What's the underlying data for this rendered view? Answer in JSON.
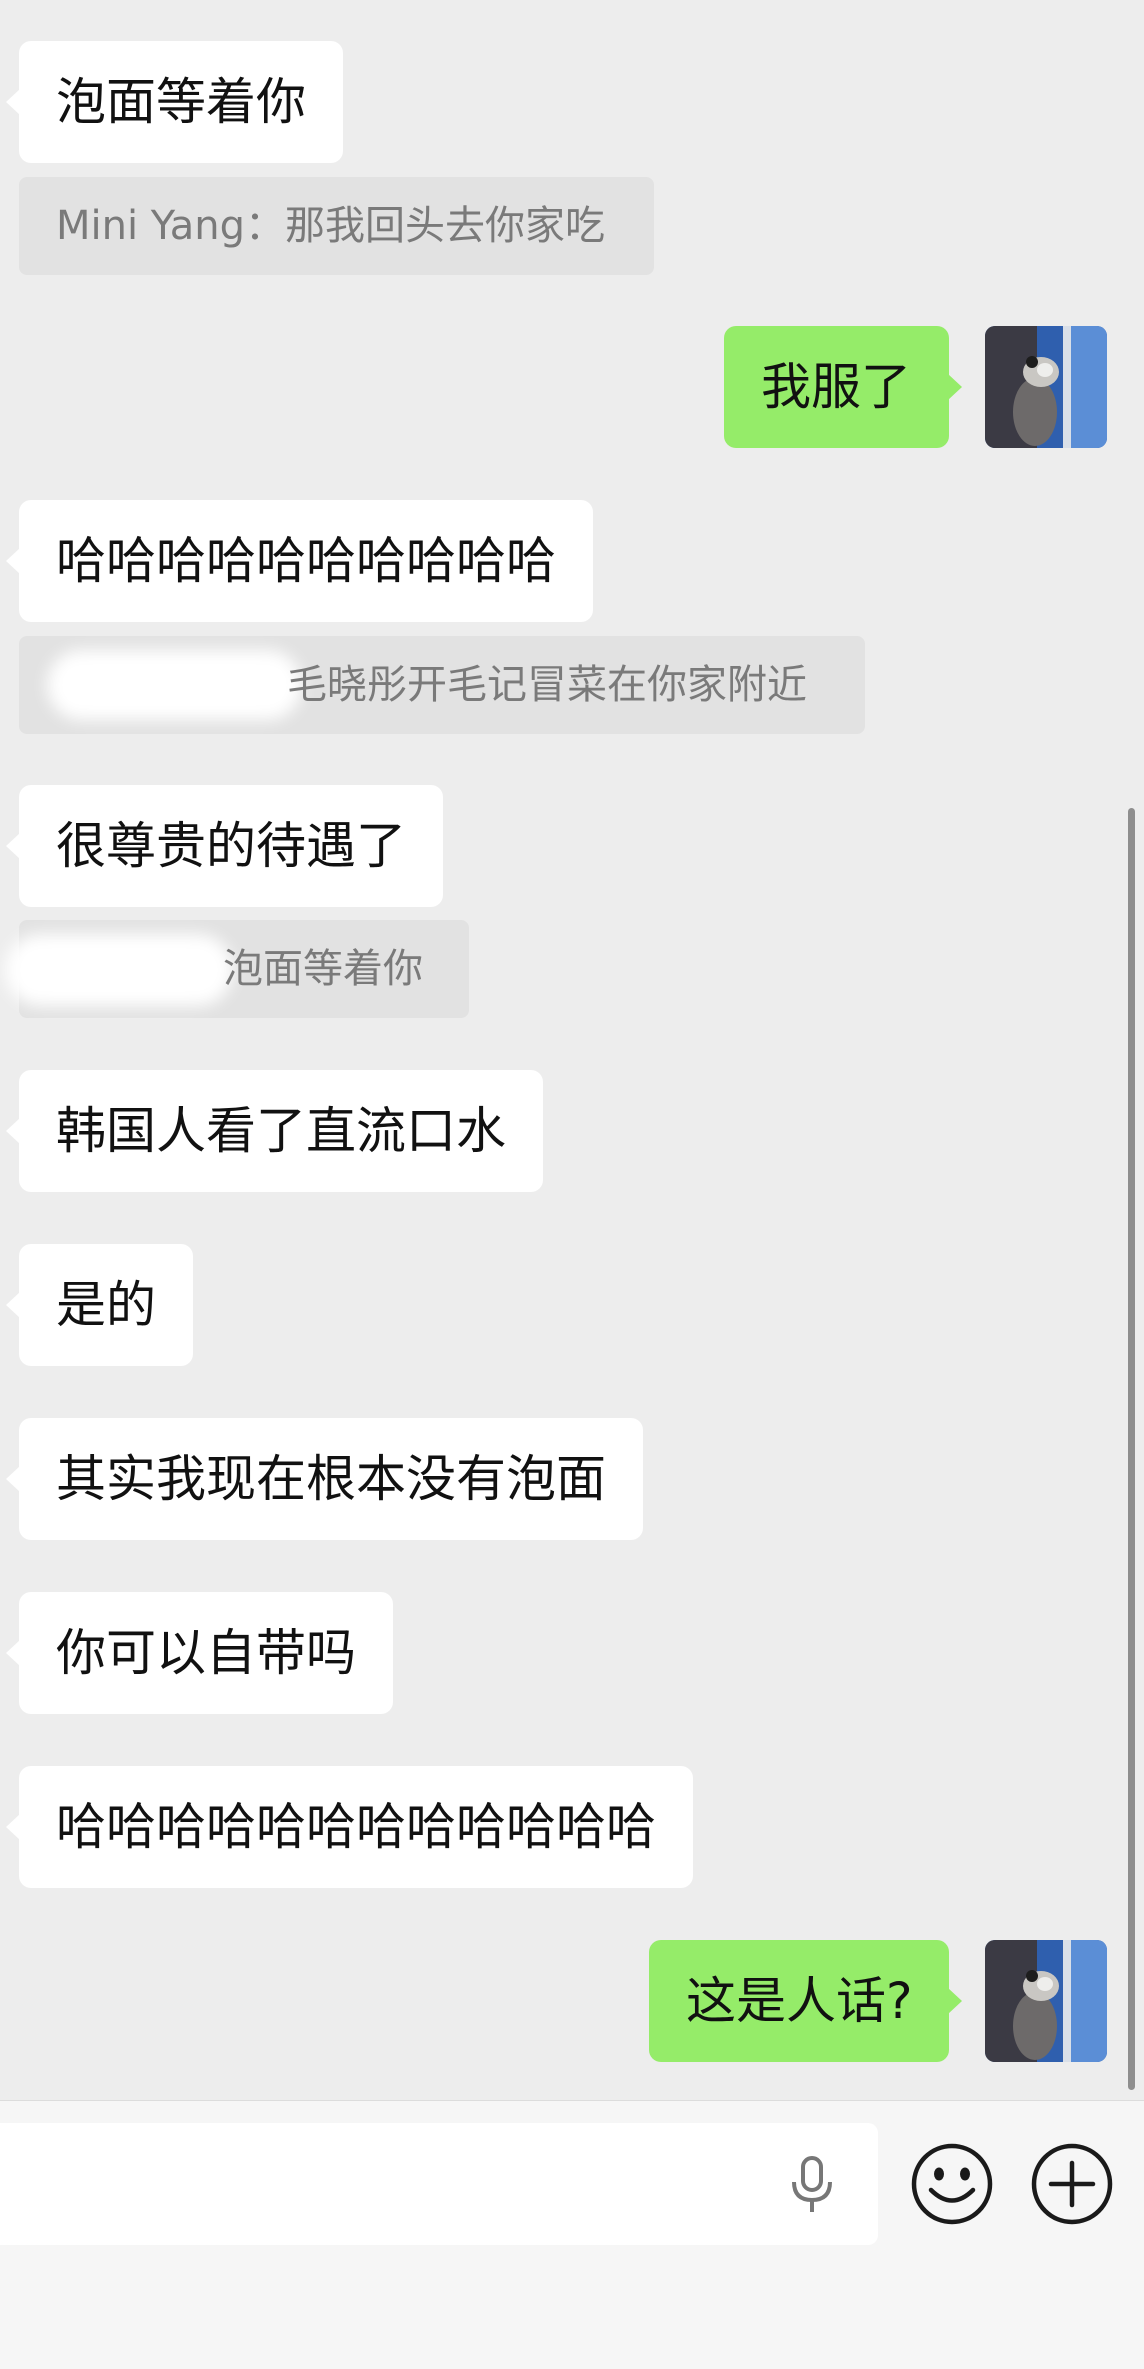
{
  "messages": [
    {
      "side": "in",
      "text": "泡面等着你"
    },
    {
      "side": "quote",
      "text": "Mini Yang：那我回头去你家吃"
    },
    {
      "side": "out",
      "text": "我服了"
    },
    {
      "side": "in",
      "text": "哈哈哈哈哈哈哈哈哈哈"
    },
    {
      "side": "quote",
      "text": "毛晓彤开毛记冒菜在你家附近"
    },
    {
      "side": "in",
      "text": "很尊贵的待遇了"
    },
    {
      "side": "quote",
      "text": "泡面等着你"
    },
    {
      "side": "in",
      "text": "韩国人看了直流口水"
    },
    {
      "side": "in",
      "text": "是的"
    },
    {
      "side": "in",
      "text": "其实我现在根本没有泡面"
    },
    {
      "side": "in",
      "text": "你可以自带吗"
    },
    {
      "side": "in",
      "text": "哈哈哈哈哈哈哈哈哈哈哈哈"
    },
    {
      "side": "out",
      "text": "这是人话?"
    }
  ],
  "input": {
    "value": ""
  },
  "icons": {
    "voice": "microphone-icon",
    "emoji": "emoji-icon",
    "more": "plus-icon"
  },
  "colors": {
    "background": "#ededed",
    "incoming_bubble": "#ffffff",
    "outgoing_bubble": "#95ec69",
    "quote_bubble": "#e2e2e2"
  }
}
